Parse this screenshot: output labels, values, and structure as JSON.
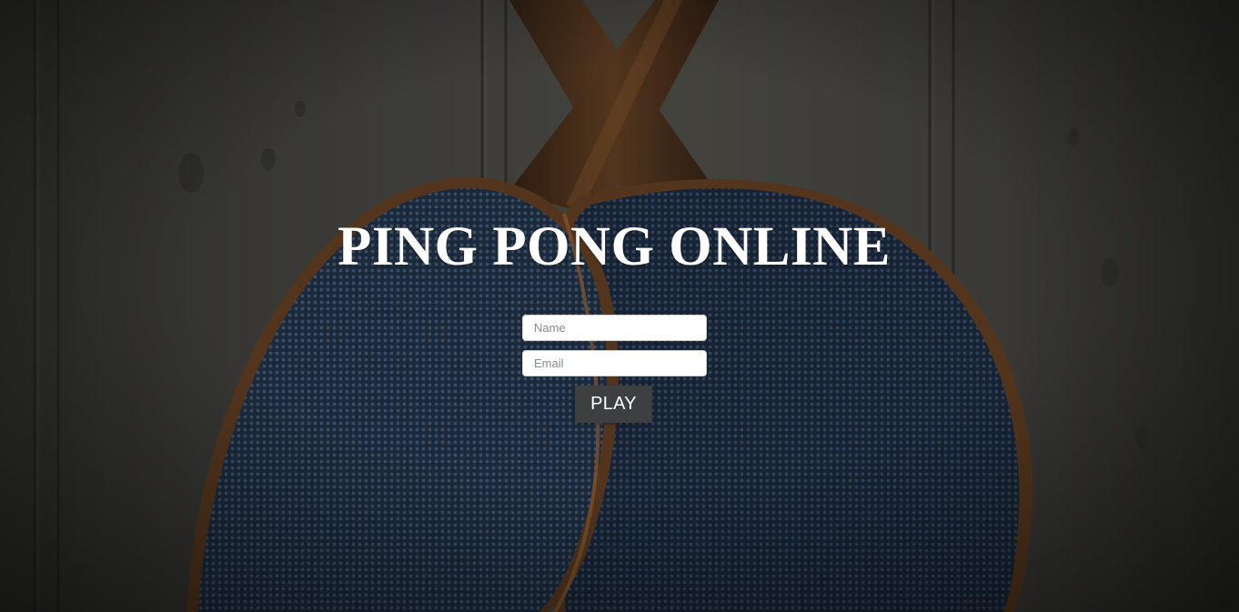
{
  "page": {
    "title": "PING PONG ONLINE"
  },
  "form": {
    "name_placeholder": "Name",
    "email_placeholder": "Email",
    "play_label": "PLAY"
  },
  "background": {
    "image": "two-table-tennis-paddles-on-wooden-wall",
    "wall_color": "#4a4a47",
    "rubber_color": "#2f4560",
    "handle_color": "#5a3a22"
  }
}
